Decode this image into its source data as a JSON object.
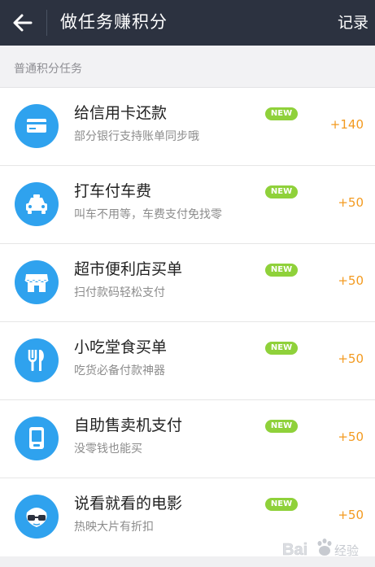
{
  "header": {
    "title": "做任务赚积分",
    "record_label": "记录"
  },
  "section": {
    "title": "普通积分任务"
  },
  "tasks": [
    {
      "title": "给信用卡还款",
      "subtitle": "部分银行支持账单同步哦",
      "badge": "NEW",
      "points": "+140",
      "icon": "credit-card-icon"
    },
    {
      "title": "打车付车费",
      "subtitle": "叫车不用等，车费支付免找零",
      "badge": "NEW",
      "points": "+50",
      "icon": "taxi-icon"
    },
    {
      "title": "超市便利店买单",
      "subtitle": "扫付款码轻松支付",
      "badge": "NEW",
      "points": "+50",
      "icon": "store-icon"
    },
    {
      "title": "小吃堂食买单",
      "subtitle": "吃货必备付款神器",
      "badge": "NEW",
      "points": "+50",
      "icon": "fork-knife-icon"
    },
    {
      "title": "自助售卖机支付",
      "subtitle": "没零钱也能买",
      "badge": "NEW",
      "points": "+50",
      "icon": "vending-machine-icon"
    },
    {
      "title": "说看就看的电影",
      "subtitle": "热映大片有折扣",
      "badge": "NEW",
      "points": "+50",
      "icon": "movie-glasses-icon"
    }
  ],
  "watermark": {
    "text": "Bai度经验"
  },
  "colors": {
    "header_bg": "#2c3240",
    "icon_blue": "#2fa2ee",
    "badge_green": "#8fd13a",
    "points_orange": "#f39a1f"
  }
}
